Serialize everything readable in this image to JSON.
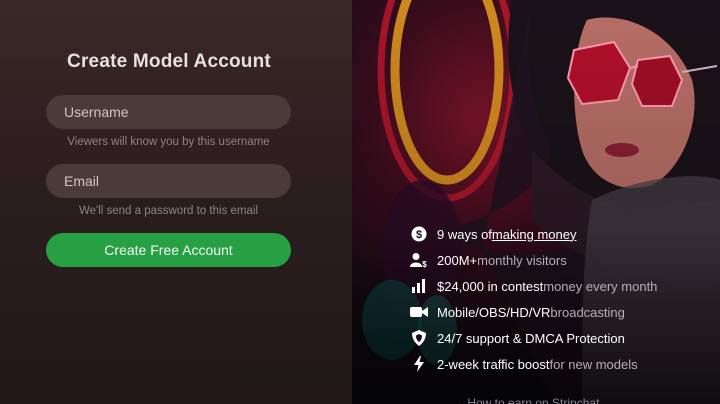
{
  "form": {
    "title": "Create Model Account",
    "username_placeholder": "Username",
    "username_hint": "Viewers will know you by this username",
    "email_placeholder": "Email",
    "email_hint": "We'll send a password to this email",
    "submit_label": "Create Free Account"
  },
  "features": [
    {
      "icon": "dollar-icon",
      "text": "9 ways of ",
      "highlight": "making money",
      "rest": ""
    },
    {
      "icon": "users-icon",
      "text": "200M+",
      "highlight": "",
      "rest": " monthly visitors"
    },
    {
      "icon": "bar-chart-icon",
      "text": "$24,000 in contest",
      "highlight": "",
      "rest": " money every month"
    },
    {
      "icon": "camera-icon",
      "text": "Mobile/OBS/HD/VR",
      "highlight": "",
      "rest": " broadcasting"
    },
    {
      "icon": "shield-icon",
      "text": "24/7 support & DMCA Protection",
      "highlight": "",
      "rest": ""
    },
    {
      "icon": "lightning-icon",
      "text": "2-week traffic boost",
      "highlight": "",
      "rest": " for new models"
    }
  ],
  "bottom_link": "→ How to earn on Stripchat",
  "colors": {
    "cta": "#27a043",
    "panel": "#2c1f1e"
  }
}
